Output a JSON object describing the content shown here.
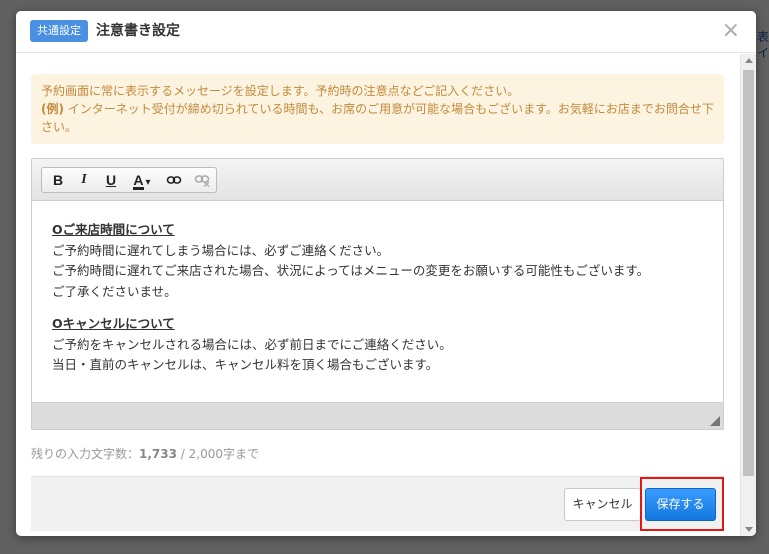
{
  "modal": {
    "badge": "共通設定",
    "title": "注意書き設定",
    "close_symbol": "×"
  },
  "notice": {
    "line1": "予約画面に常に表示するメッセージを設定します。予約時の注意点などご記入ください。",
    "example_label": "(例)",
    "line2": " インターネット受付が締め切られている時間も、お席のご用意が可能な場合もございます。お気軽にお店までお問合せ下さい。"
  },
  "toolbar": {
    "bold": "B",
    "italic": "I",
    "underline": "U",
    "font_color": "A",
    "dropdown_caret": "▾",
    "link_icon": "link-icon",
    "unlink_icon": "unlink-icon"
  },
  "editor": {
    "section1_heading": "Oご来店時間について",
    "section1_lines": [
      "ご予約時間に遅れてしまう場合には、必ずご連絡ください。",
      "ご予約時間に遅れてご来店された場合、状況によってはメニューの変更をお願いする可能性もございます。",
      "ご了承くださいませ。"
    ],
    "section2_heading": "Oキャンセルについて",
    "section2_lines": [
      "ご予約をキャンセルされる場合には、必ず前日までにご連絡ください。",
      "当日・直前のキャンセルは、キャンセル料を頂く場合もございます。"
    ]
  },
  "char_count": {
    "label": "残りの入力文字数：",
    "remaining": "1,733",
    "limit": " / 2,000字まで"
  },
  "footer": {
    "cancel_label": "キャンセル",
    "save_label": "保存する"
  },
  "colors": {
    "badge_bg": "#4a90e2",
    "notice_bg": "#fdf3e1",
    "notice_text": "#c28a3a",
    "save_bg": "#1478e0",
    "highlight": "#e01818"
  }
}
